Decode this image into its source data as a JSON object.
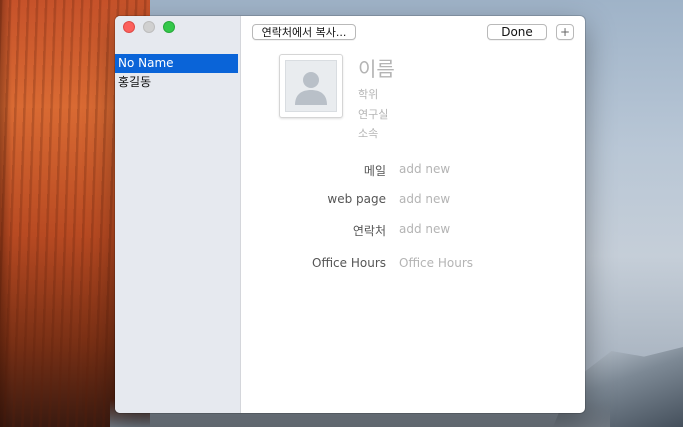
{
  "window": {
    "controls": [
      "close-icon",
      "minimize-icon",
      "zoom-icon"
    ]
  },
  "sidebar": {
    "items": [
      {
        "label": "No Name",
        "selected": true
      },
      {
        "label": "홍길동",
        "selected": false
      }
    ]
  },
  "toolbar": {
    "copy_label": "연락처에서 복사...",
    "done_label": "Done",
    "add_label": "+"
  },
  "card": {
    "photo_icon": "person-silhouette-icon",
    "name_placeholder": "이름",
    "subfields": [
      "학위",
      "연구실",
      "소속"
    ],
    "fields": [
      {
        "label": "메일",
        "value": "add new"
      },
      {
        "label": "web page",
        "value": "add new"
      },
      {
        "label": "연락처",
        "value": "add new"
      },
      {
        "label": "Office Hours",
        "value": "Office Hours"
      }
    ]
  },
  "colors": {
    "selection": "#0a64d8",
    "close": "#fc605c",
    "zoom": "#34c84a",
    "placeholder_text": "#b4b4b4"
  }
}
